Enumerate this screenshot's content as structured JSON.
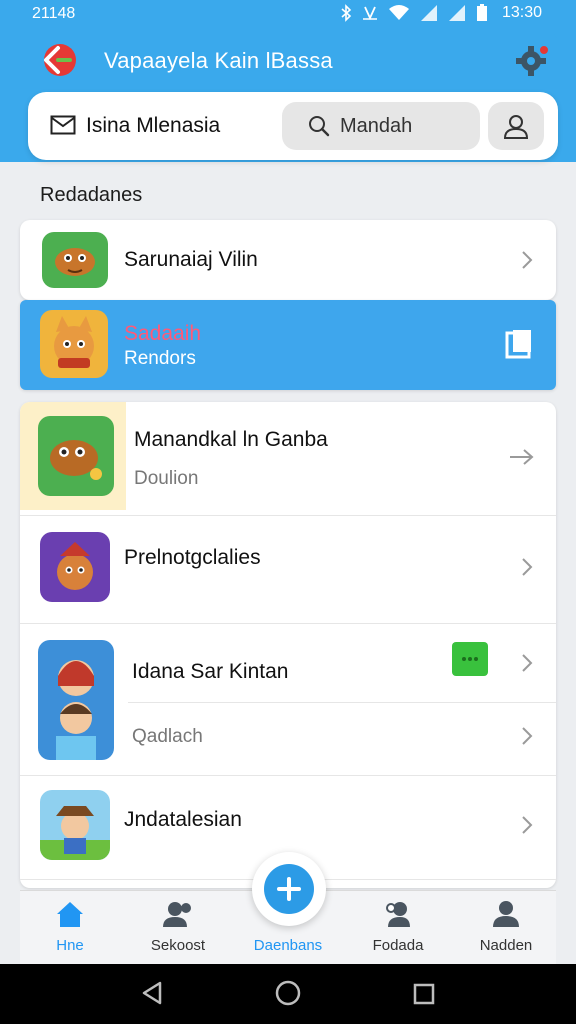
{
  "status_bar": {
    "left_time": "21148",
    "clock": "13:30"
  },
  "header": {
    "title": "Vapaayela Kain lBassa",
    "search_row_title": "Isina Mlenasia",
    "search_placeholder": "Mandah"
  },
  "section": {
    "title": "Redadanes"
  },
  "cards": [
    {
      "title": "Sarunaiaj Vilin"
    },
    {
      "title": "Sadaaih",
      "subtitle": "Rendors"
    }
  ],
  "list": [
    {
      "title": "Manandkal ln Ganba",
      "subtitle": "Doulion"
    },
    {
      "title": "Prelnotgclalies"
    },
    {
      "title": "Idana Sar Kintan",
      "subtitle": "Qadlach"
    },
    {
      "title": "Jndatalesian"
    }
  ],
  "bottom_nav": [
    {
      "label": "Hne",
      "icon": "home-icon",
      "active": true
    },
    {
      "label": "Sekoost",
      "icon": "people-icon"
    },
    {
      "label": "Daenbans",
      "icon": "add-icon"
    },
    {
      "label": "Fodada",
      "icon": "person-pin-icon"
    },
    {
      "label": "Nadden",
      "icon": "profile-icon"
    }
  ],
  "colors": {
    "primary": "#3aa9ec",
    "accent": "#2196f3",
    "badge": "#39c13d",
    "alert": "#e53935"
  }
}
